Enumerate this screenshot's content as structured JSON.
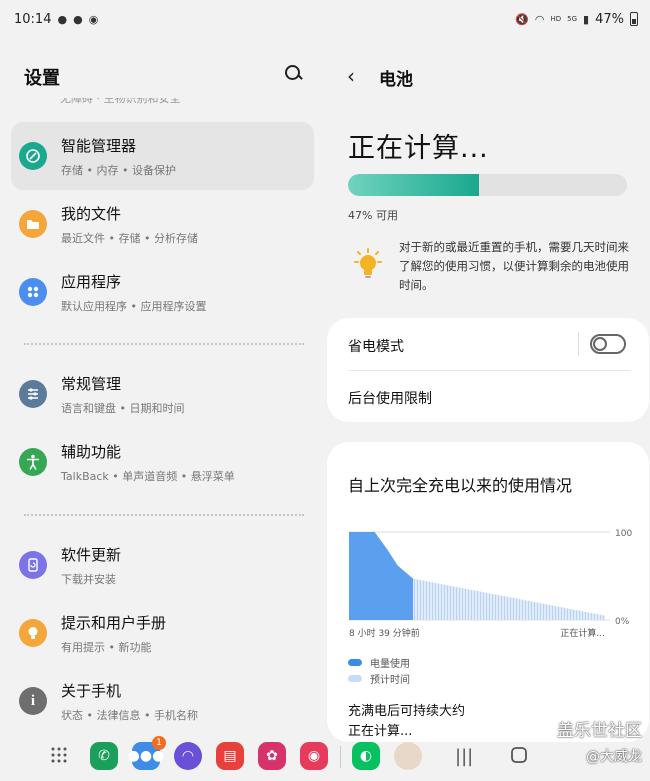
{
  "status_bar": {
    "time": "10:14",
    "battery_percent": "47%",
    "hd": "HD",
    "net": "5G"
  },
  "left_pane": {
    "title": "设置",
    "cut_off_text": "无障碍 · 生物识别和安全",
    "items": [
      {
        "title": "智能管理器",
        "subtitle": "存储 • 内存 • 设备保护",
        "color": "#1aa88e",
        "icon": "device-care-icon",
        "active": true
      },
      {
        "title": "我的文件",
        "subtitle": "最近文件 • 存储 • 分析存储",
        "color": "#f4a63b",
        "icon": "folder-icon"
      },
      {
        "title": "应用程序",
        "subtitle": "默认应用程序 • 应用程序设置",
        "color": "#4a8ff0",
        "icon": "apps-icon"
      },
      {
        "title": "常规管理",
        "subtitle": "语言和键盘 • 日期和时间",
        "color": "#5c7a99",
        "icon": "sliders-icon"
      },
      {
        "title": "辅助功能",
        "subtitle": "TalkBack • 单声道音频 • 悬浮菜单",
        "color": "#34a853",
        "icon": "accessibility-icon"
      },
      {
        "title": "软件更新",
        "subtitle": "下载并安装",
        "color": "#7b74e8",
        "icon": "update-icon"
      },
      {
        "title": "提示和用户手册",
        "subtitle": "有用提示 • 新功能",
        "color": "#f4a63b",
        "icon": "lightbulb-icon"
      },
      {
        "title": "关于手机",
        "subtitle": "状态 • 法律信息 • 手机名称",
        "color": "#6e6e6e",
        "icon": "info-icon"
      }
    ]
  },
  "right_pane": {
    "back_label": "‹",
    "title": "电池",
    "calculating": "正在计算...",
    "battery_level": 0.47,
    "available": "47% 可用",
    "tip": "对于新的或最近重置的手机，需要几天时间来了解您的使用习惯，以便计算剩余的电池使用时间。",
    "power_saving": "省电模式",
    "power_saving_on": false,
    "background_limits": "后台使用限制",
    "usage_title": "自上次完全充电以来的使用情况",
    "legend_used": "电量使用",
    "legend_predicted": "预计时间",
    "full_charge_text": "充满电后可持续大约",
    "full_charge_value": "正在计算..."
  },
  "chart_data": {
    "type": "area",
    "ylim": [
      0,
      100
    ],
    "y_tick_labels": [
      "100",
      "0%"
    ],
    "x_tick_labels": [
      "8 小时 39 分钟前",
      "正在计算..."
    ],
    "series": [
      {
        "name": "电量使用",
        "x": [
          0,
          10,
          15,
          19,
          25
        ],
        "values": [
          100,
          100,
          80,
          62,
          47
        ]
      },
      {
        "name": "预计时间",
        "x": [
          25,
          100
        ],
        "values": [
          47,
          5
        ]
      }
    ]
  },
  "dock": {
    "badge_count": "1",
    "watermark_line1": "盖乐世社区",
    "watermark_line2": "@大威龙"
  }
}
